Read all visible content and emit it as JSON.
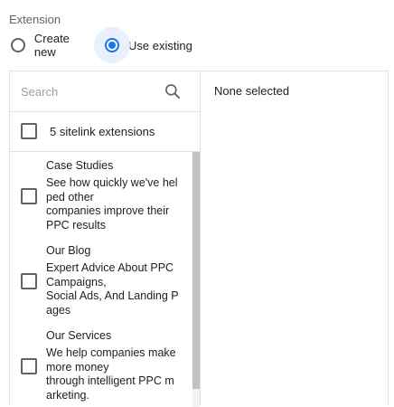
{
  "extension": {
    "label": "Extension",
    "options": [
      {
        "label": "Create new",
        "checked": false
      },
      {
        "label": "Use existing",
        "checked": true
      }
    ]
  },
  "search": {
    "placeholder": "Search",
    "icon": "search-icon"
  },
  "select_all": {
    "label": "5 sitelink extensions",
    "checked": false
  },
  "items": [
    {
      "title": "Case Studies",
      "description": "See how quickly we've hel\nped other\ncompanies improve their\nPPC results",
      "checked": false
    },
    {
      "title": "Our Blog",
      "description": "Expert Advice About PPC\nCampaigns,\nSocial Ads, And Landing P\nages",
      "checked": false
    },
    {
      "title": "Our Services",
      "description": "We help companies make\nmore money\nthrough intelligent PPC m\narketing.",
      "checked": false
    }
  ],
  "selection": {
    "label": "None selected"
  },
  "colors": {
    "accent": "#1a73e8",
    "accent_halo": "#e8f0fe",
    "border": "#e0e0e0",
    "muted_text": "#5f6368",
    "scroll_thumb": "#c1c1c1"
  }
}
